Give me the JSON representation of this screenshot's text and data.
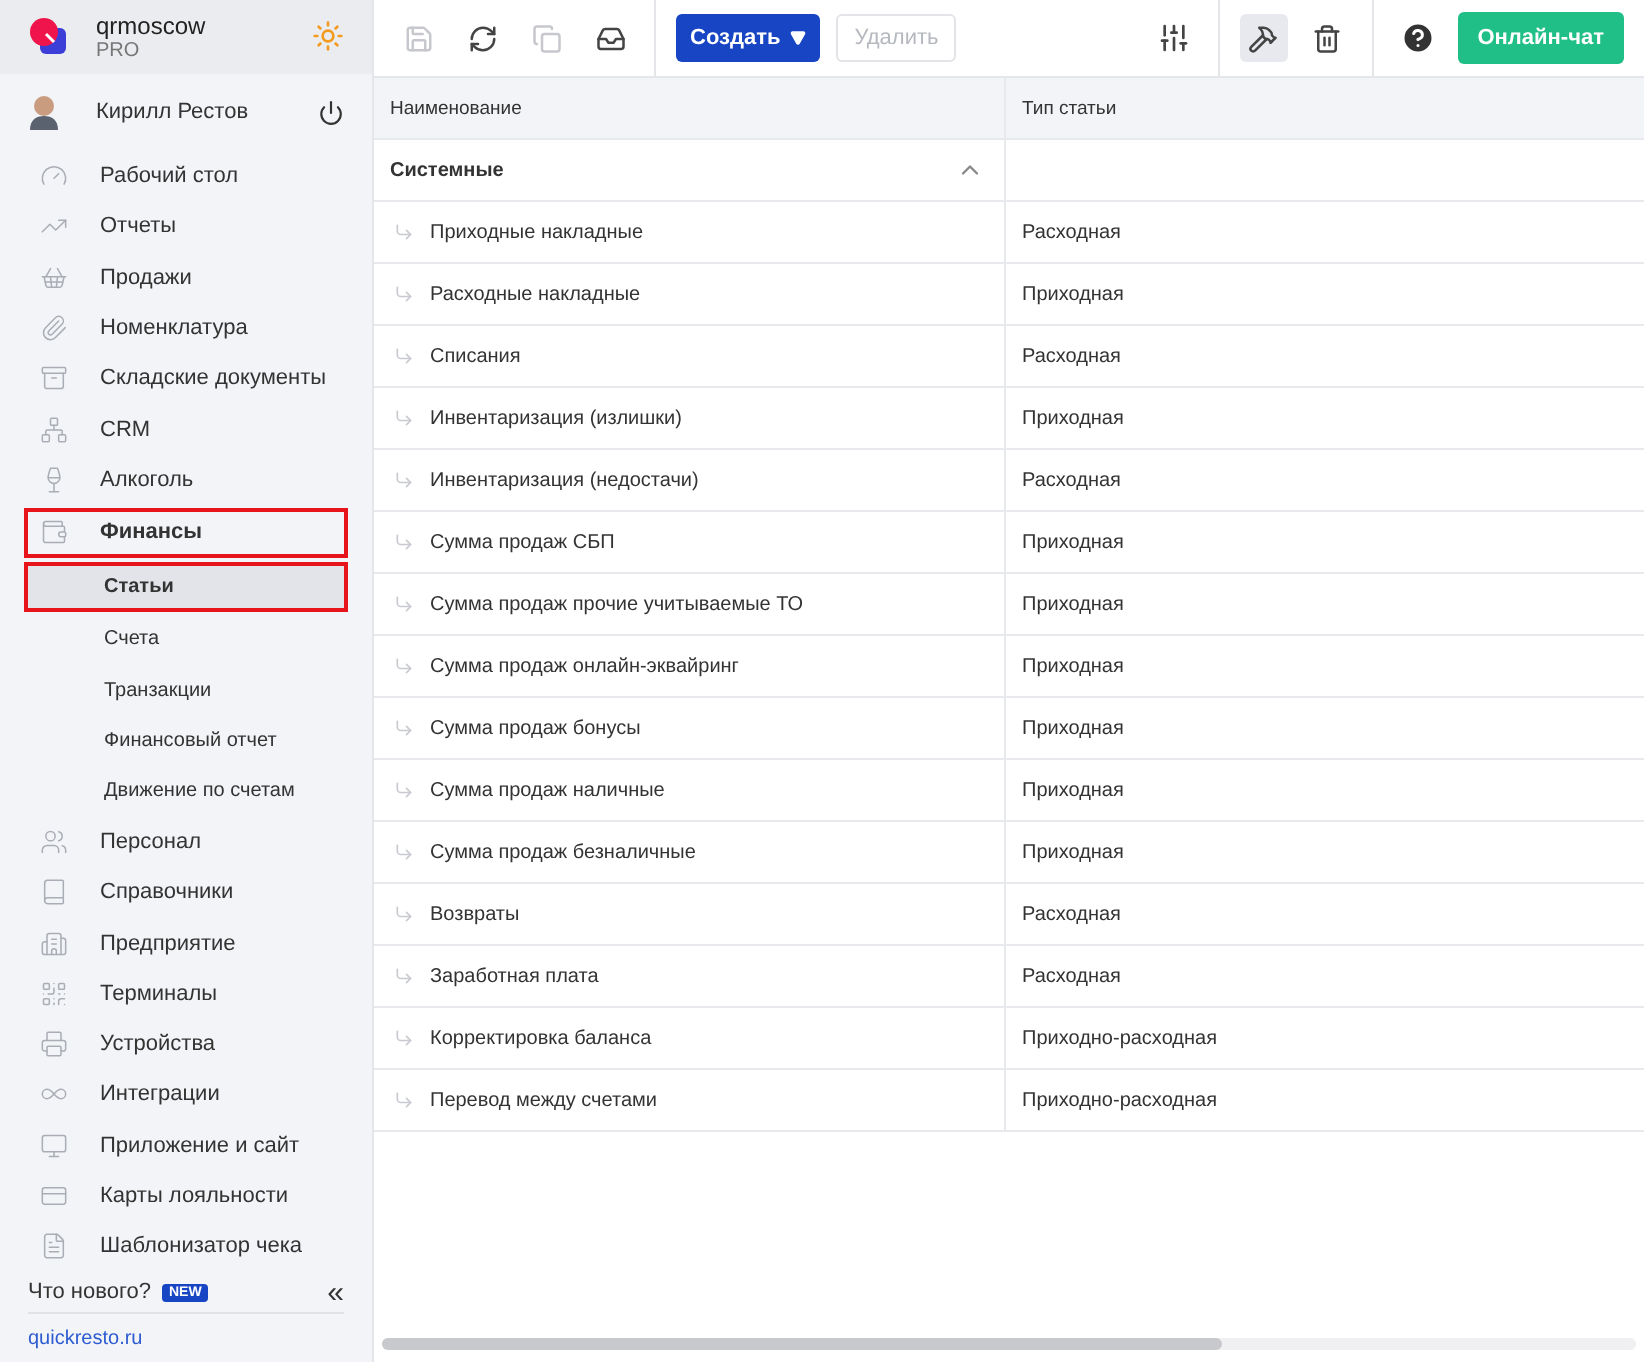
{
  "app": {
    "account": "qrmoscow",
    "plan": "PRO"
  },
  "user": {
    "name": "Кирилл Рестов"
  },
  "nav": [
    {
      "label": "Рабочий стол",
      "selected": false,
      "highlighted": false
    },
    {
      "label": "Отчеты",
      "selected": false,
      "highlighted": false
    },
    {
      "label": "Продажи",
      "selected": false,
      "highlighted": false
    },
    {
      "label": "Номенклатура",
      "selected": false,
      "highlighted": false
    },
    {
      "label": "Складские документы",
      "selected": false,
      "highlighted": false
    },
    {
      "label": "CRM",
      "selected": false,
      "highlighted": false
    },
    {
      "label": "Алкоголь",
      "selected": false,
      "highlighted": false
    },
    {
      "label": "Финансы",
      "selected": false,
      "highlighted": true,
      "expanded": true,
      "children": [
        {
          "label": "Статьи",
          "selected": true,
          "highlighted": true
        },
        {
          "label": "Счета",
          "selected": false,
          "highlighted": false
        },
        {
          "label": "Транзакции",
          "selected": false,
          "highlighted": false
        },
        {
          "label": "Финансовый отчет",
          "selected": false,
          "highlighted": false
        },
        {
          "label": "Движение по счетам",
          "selected": false,
          "highlighted": false
        }
      ]
    },
    {
      "label": "Персонал",
      "selected": false,
      "highlighted": false
    },
    {
      "label": "Справочники",
      "selected": false,
      "highlighted": false
    },
    {
      "label": "Предприятие",
      "selected": false,
      "highlighted": false
    },
    {
      "label": "Терминалы",
      "selected": false,
      "highlighted": false
    },
    {
      "label": "Устройства",
      "selected": false,
      "highlighted": false
    },
    {
      "label": "Интеграции",
      "selected": false,
      "highlighted": false
    },
    {
      "label": "Приложение и сайт",
      "selected": false,
      "highlighted": false
    },
    {
      "label": "Карты лояльности",
      "selected": false,
      "highlighted": false
    },
    {
      "label": "Шаблонизатор чека",
      "selected": false,
      "highlighted": false
    }
  ],
  "footer": {
    "whats_new": "Что нового?",
    "badge": "NEW",
    "collapse": "«",
    "link": "quickresto.ru"
  },
  "toolbar": {
    "create": "Создать",
    "delete": {
      "label": "Удалить",
      "disabled": true
    },
    "tools_selected": true,
    "chat": "Онлайн-чат"
  },
  "table": {
    "columns": [
      "Наименование",
      "Тип статьи"
    ],
    "groups": [
      {
        "name": "Системные",
        "expanded": true,
        "rows": [
          {
            "name": "Приходные накладные",
            "type": "Расходная"
          },
          {
            "name": "Расходные накладные",
            "type": "Приходная"
          },
          {
            "name": "Списания",
            "type": "Расходная"
          },
          {
            "name": "Инвентаризация (излишки)",
            "type": "Приходная"
          },
          {
            "name": "Инвентаризация (недостачи)",
            "type": "Расходная"
          },
          {
            "name": "Сумма продаж СБП",
            "type": "Приходная"
          },
          {
            "name": "Сумма продаж прочие учитываемые ТО",
            "type": "Приходная"
          },
          {
            "name": "Сумма продаж онлайн-эквайринг",
            "type": "Приходная"
          },
          {
            "name": "Сумма продаж бонусы",
            "type": "Приходная"
          },
          {
            "name": "Сумма продаж наличные",
            "type": "Приходная"
          },
          {
            "name": "Сумма продаж безналичные",
            "type": "Приходная"
          },
          {
            "name": "Возвраты",
            "type": "Расходная"
          },
          {
            "name": "Заработная плата",
            "type": "Расходная"
          },
          {
            "name": "Корректировка баланса",
            "type": "Приходно-расходная"
          },
          {
            "name": "Перевод между счетами",
            "type": "Приходно-расходная"
          }
        ]
      }
    ]
  }
}
